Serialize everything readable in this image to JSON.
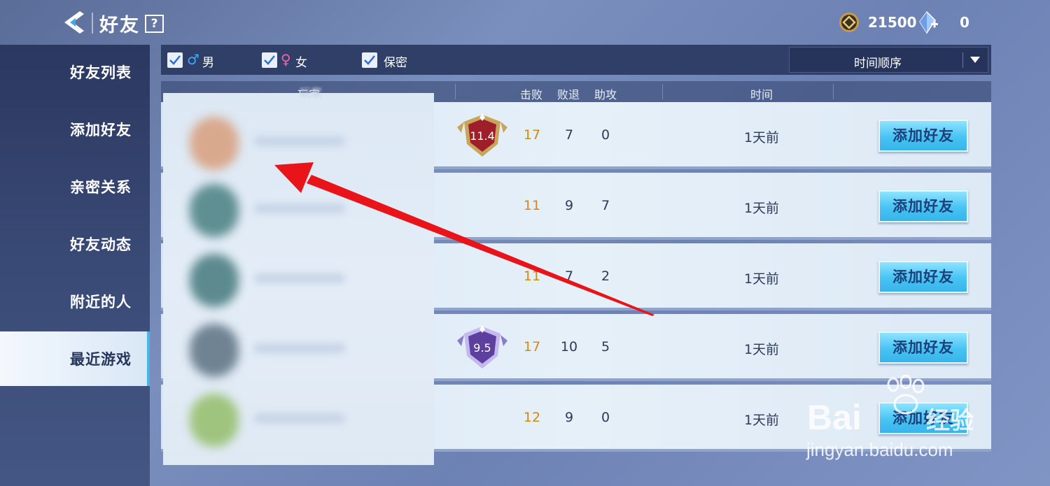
{
  "header": {
    "title": "好友",
    "help_label": "?",
    "coins": "21500",
    "gems": "0"
  },
  "sidebar": {
    "items": [
      {
        "label": "好友列表"
      },
      {
        "label": "添加好友"
      },
      {
        "label": "亲密关系"
      },
      {
        "label": "好友动态"
      },
      {
        "label": "附近的人"
      },
      {
        "label": "最近游戏",
        "active": true
      }
    ]
  },
  "filters": {
    "male": {
      "label": "男",
      "checked": true,
      "icon": "♂"
    },
    "female": {
      "label": "女",
      "checked": true,
      "icon": "♀"
    },
    "secret": {
      "label": "保密",
      "checked": true
    },
    "sort": "时间顺序"
  },
  "table": {
    "headers": {
      "player": "玩家",
      "kills": "击败",
      "deaths": "败退",
      "assists": "助攻",
      "time": "时间"
    },
    "rows": [
      {
        "badge": "11.4",
        "kills": "17",
        "deaths": "7",
        "assists": "0",
        "time": "1天前",
        "action": "添加好友"
      },
      {
        "badge": "",
        "kills": "11",
        "deaths": "9",
        "assists": "7",
        "time": "1天前",
        "action": "添加好友"
      },
      {
        "badge": "",
        "kills": "11",
        "deaths": "7",
        "assists": "2",
        "time": "1天前",
        "action": "添加好友"
      },
      {
        "badge": "9.5",
        "kills": "17",
        "deaths": "10",
        "assists": "5",
        "time": "1天前",
        "action": "添加好友"
      },
      {
        "badge": "",
        "kills": "12",
        "deaths": "9",
        "assists": "0",
        "time": "1天前",
        "action": "添加好友"
      }
    ]
  },
  "watermark": {
    "brand": "Bai",
    "brand_cn": "经验",
    "url": "jingyan.baidu.com"
  },
  "colors": {
    "kills": "#d08a12",
    "accent": "#46c4f3",
    "arrow": "#e8141a"
  }
}
